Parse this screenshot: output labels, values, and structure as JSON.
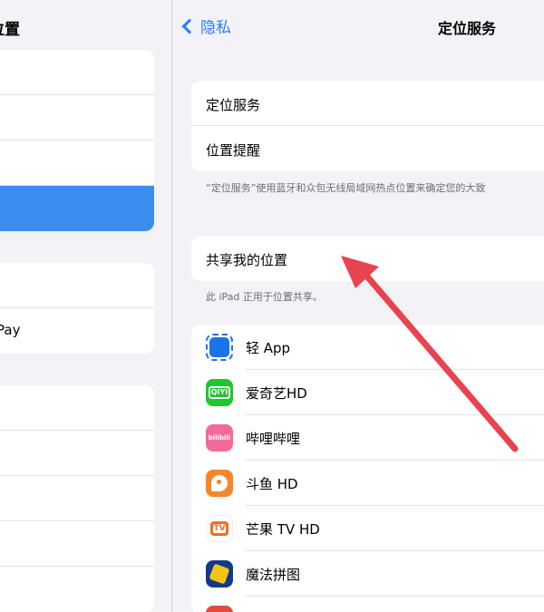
{
  "left": {
    "title": "位置",
    "pay_label": "Pay"
  },
  "nav": {
    "back_label": "隐私",
    "title": "定位服务"
  },
  "location_group": {
    "items": [
      {
        "label": "定位服务"
      },
      {
        "label": "位置提醒"
      }
    ],
    "footnote": "“定位服务”使用蓝牙和众包无线局域网热点位置来确定您的大致"
  },
  "share_group": {
    "label": "共享我的位置",
    "footnote": "此 iPad 正用于位置共享。"
  },
  "apps": [
    {
      "label": "轻 App",
      "icon": "light-app-icon"
    },
    {
      "label": "爱奇艺HD",
      "icon": "iqiyi-icon",
      "icon_text": "QIYI"
    },
    {
      "label": "哔哩哔哩",
      "icon": "bilibili-icon",
      "icon_text": "bilibili"
    },
    {
      "label": "斗鱼 HD",
      "icon": "douyu-icon"
    },
    {
      "label": "芒果 TV HD",
      "icon": "mango-tv-icon",
      "icon_text": "TV"
    },
    {
      "label": "魔法拼图",
      "icon": "puzzle-icon"
    }
  ],
  "colors": {
    "accent": "#2f7cf6",
    "selected_row": "#3b8ef0",
    "annotation_arrow": "#e8434f",
    "background": "#f2f2f7"
  }
}
